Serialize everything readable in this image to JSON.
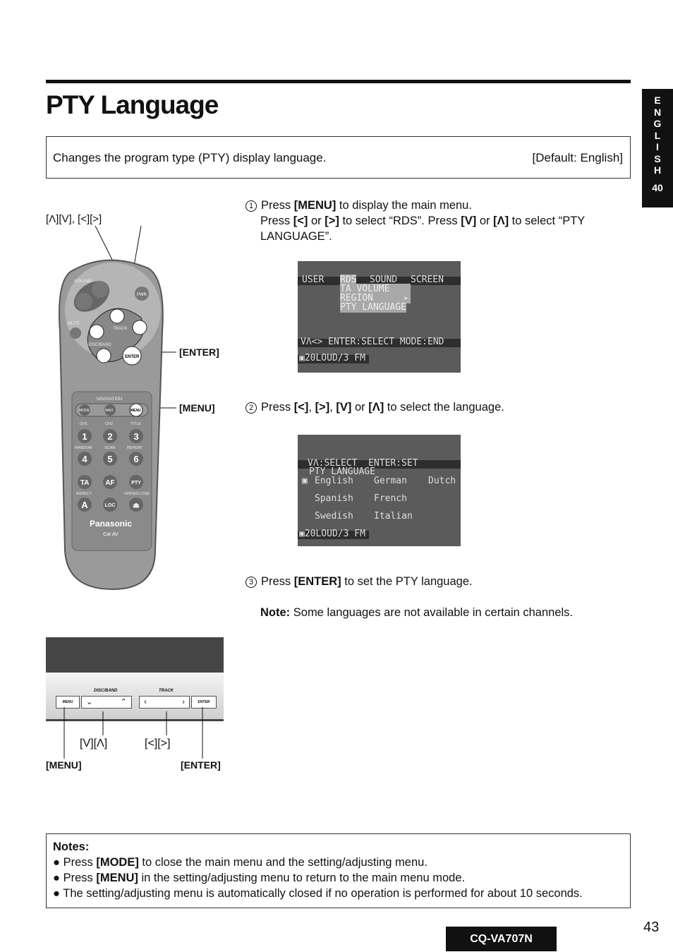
{
  "header": {
    "title": "PTY Language",
    "description": "Changes the program type (PTY) display language.",
    "default": "[Default: English]"
  },
  "side_tab": {
    "letters": [
      "E",
      "N",
      "G",
      "L",
      "I",
      "S",
      "H"
    ],
    "section": "40"
  },
  "steps": [
    {
      "num": "1",
      "a": "Press ",
      "b": "[MENU]",
      "c": " to display the main menu.",
      "line2a": "Press ",
      "k1": "[<]",
      "or1": " or ",
      "k2": "[>]",
      "line2b": " to select “RDS”. Press ",
      "k3": "[V]",
      "or2": " or ",
      "k4": "[Λ]",
      "line2c": " to select “PTY LANGUAGE”."
    },
    {
      "num": "2",
      "a": "Press ",
      "k1": "[<]",
      "s1": ", ",
      "k2": "[>]",
      "s2": ", ",
      "k3": "[V]",
      "or": " or ",
      "k4": "[Λ]",
      "c": " to select the language."
    },
    {
      "num": "3",
      "a": "Press ",
      "b": "[ENTER]",
      "c": " to set the PTY language.",
      "note_label": "Note:",
      "note": " Some languages are not available in certain channels."
    }
  ],
  "screen1": {
    "tabs": [
      "USER",
      "RDS",
      "SOUND",
      "SCREEN"
    ],
    "items": [
      "TA VOLUME",
      "REGION",
      "PTY LANGUAGE"
    ],
    "region_marker": "▸",
    "footer": "VΛ<> ENTER:SELECT MODE:END",
    "status": "▣20LOUD/3 FM"
  },
  "screen2": {
    "header": "VΛ:SELECT  ENTER:SET",
    "title": "PTY LANGUAGE",
    "marker": "▣",
    "languages": [
      "English",
      "German",
      "Dutch",
      "Spanish",
      "French",
      "Swedish",
      "Italian"
    ],
    "status": "▣20LOUD/3 FM"
  },
  "remote": {
    "callout_arrows": "[Λ][V], [<][>]",
    "enter_label": "[ENTER]",
    "menu_label": "[MENU]",
    "buttons": {
      "volume": "VOLUME",
      "pwr": "PWR",
      "mute": "MUTE",
      "track": "TRACK",
      "disc_band": "DISC/BAND",
      "enter": "ENTER",
      "navigation": "NAVIGATION",
      "mode": "MODE",
      "navi": "NAVI",
      "menu": "MENU",
      "ch1": "CH1",
      "ch2": "CH2",
      "title": "TITLE",
      "random": "RANDOM",
      "scan": "SCAN",
      "repeat": "REPEAT",
      "n1": "1",
      "n2": "2",
      "n3": "3",
      "n4": "4",
      "n5": "5",
      "n6": "6",
      "ta": "TA",
      "af": "AF",
      "pty": "PTY",
      "aspect": "ASPECT",
      "open_close": "OPEN/CLOSE",
      "a": "A",
      "loc": "LOC",
      "eject": "⏏",
      "brand": "Panasonic",
      "sub": "Car AV"
    }
  },
  "unit": {
    "disc_band": "DISC/BAND",
    "track": "TRACK",
    "menu": "MENU",
    "enter": "ENTER",
    "down_up": "[V][Λ]",
    "left_right": "[<][>]",
    "menu_label": "[MENU]",
    "enter_label": "[ENTER]"
  },
  "notes": {
    "title": "Notes:",
    "items": [
      {
        "a": "Press ",
        "b": "[MODE]",
        "c": " to close the main menu and the setting/adjusting menu."
      },
      {
        "a": "Press ",
        "b": "[MENU]",
        "c": " in the setting/adjusting menu to return to the main menu mode."
      },
      {
        "a": "The setting/adjusting menu is automatically closed if no operation is performed for about 10 seconds.",
        "b": "",
        "c": ""
      }
    ]
  },
  "footer": {
    "model": "CQ-VA707N",
    "page": "43"
  }
}
